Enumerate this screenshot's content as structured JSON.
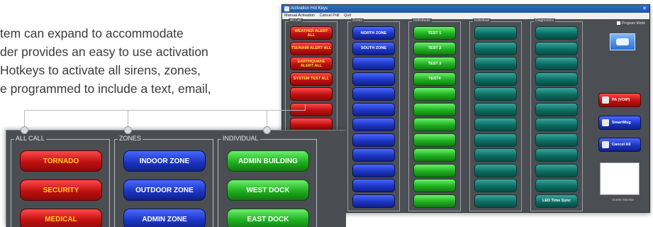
{
  "copy_lines": [
    "tem can expand to accommodate",
    "der provides an easy to use activation",
    " Hotkeys to activate all sirens, zones,",
    "e programmed to include a text, email,"
  ],
  "window": {
    "title": "Activation Hot Keys",
    "close_glyph": "✕",
    "menu": [
      "Manual Activation",
      "Cancel Poll",
      "Quit"
    ],
    "program_mode": "Program Mode",
    "screen_monitor_label": "Screen Monitor"
  },
  "columns": [
    {
      "caption": "All Call",
      "color": "red",
      "buttons": [
        "WEATHER ALERT ALL",
        "TSUNAMI ALERT ALL",
        "EARTHQUAKE ALERT ALL",
        "SYSTEM TEST ALL",
        "",
        "",
        "",
        "",
        "",
        "",
        "",
        ""
      ]
    },
    {
      "caption": "Zones",
      "color": "blue",
      "buttons": [
        "NORTH ZONE",
        "SOUTH ZONE",
        "",
        "",
        "",
        "",
        "",
        "",
        "",
        "",
        "",
        ""
      ]
    },
    {
      "caption": "Individuals",
      "color": "green",
      "buttons": [
        "TEST 1",
        "TEST 2",
        "TEST 3",
        "TEST4",
        "",
        "",
        "",
        "",
        "",
        "",
        "",
        ""
      ]
    },
    {
      "caption": "Individual",
      "color": "teal",
      "buttons": [
        "",
        "",
        "",
        "",
        "",
        "",
        "",
        "",
        "",
        "",
        "",
        ""
      ]
    },
    {
      "caption": "Diagnostics",
      "color": "teal",
      "buttons": [
        "",
        "",
        "",
        "",
        "",
        "",
        "",
        "",
        "",
        "",
        "",
        "LED Time Sync"
      ]
    }
  ],
  "side_buttons": [
    {
      "label": "PA (VOIP)",
      "color": "red"
    },
    {
      "label": "SmartMsg",
      "color": "blue"
    },
    {
      "label": "Cancel All",
      "color": "blue"
    }
  ],
  "zoom": {
    "groups": [
      {
        "caption": "ALL CALL",
        "color": "red",
        "buttons": [
          "TORNADO",
          "SECURITY",
          "MEDICAL"
        ]
      },
      {
        "caption": "ZONES",
        "color": "blue",
        "buttons": [
          "INDOOR ZONE",
          "OUTDOOR ZONE",
          "ADMIN ZONE"
        ]
      },
      {
        "caption": "INDIVIDUAL",
        "color": "green",
        "buttons": [
          "ADMIN BUILDING",
          "WEST DOCK",
          "EAST DOCK"
        ]
      }
    ]
  }
}
